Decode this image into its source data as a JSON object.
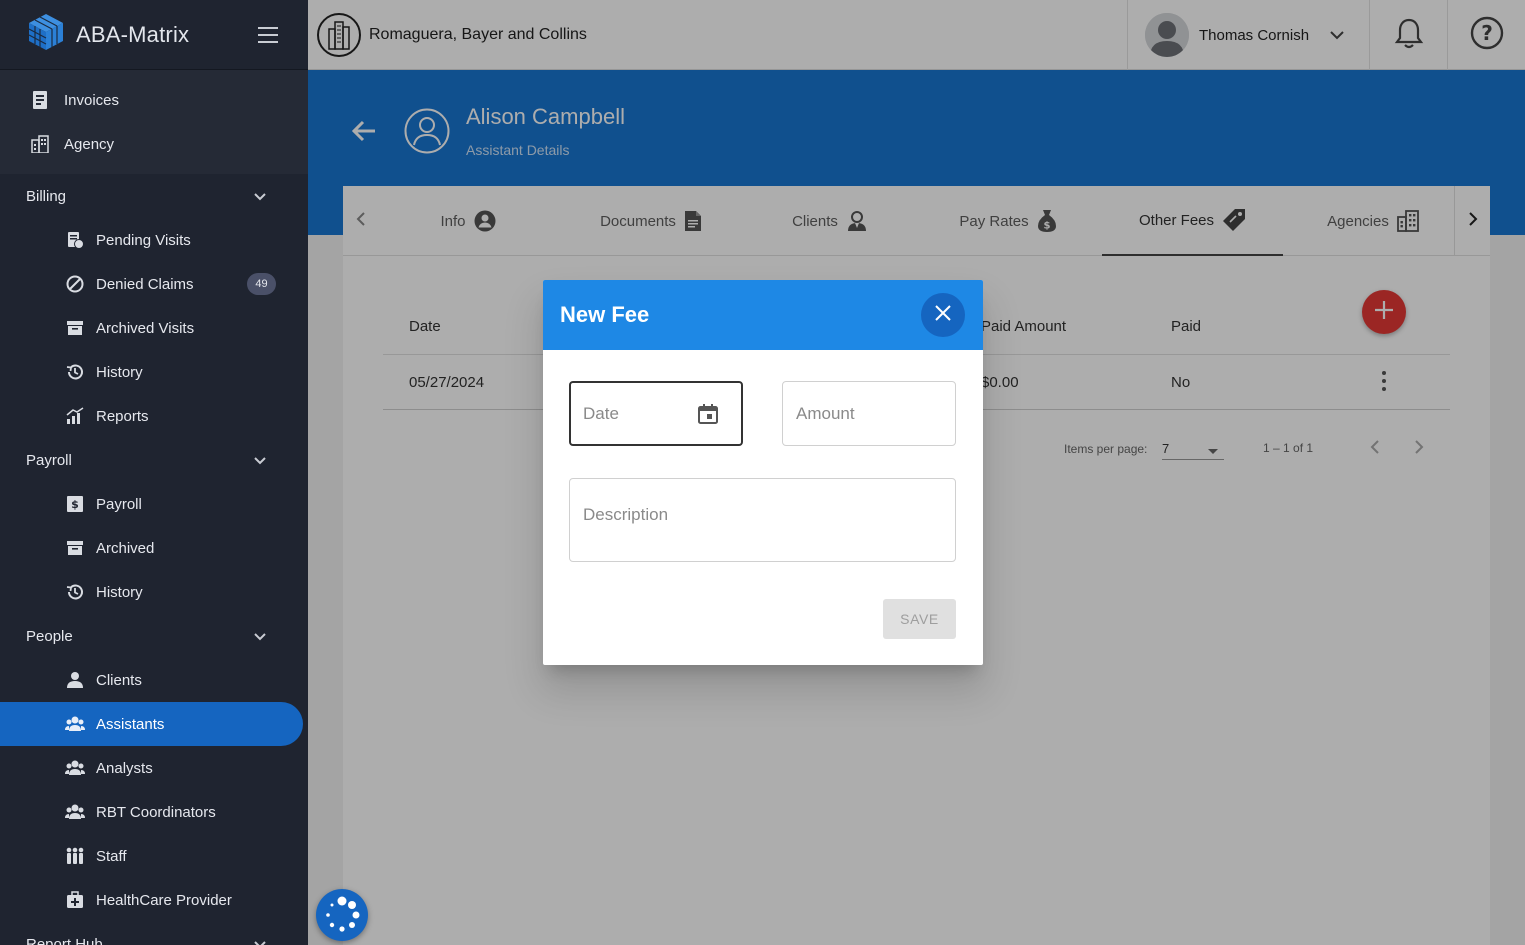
{
  "app": {
    "name": "ABA-Matrix"
  },
  "topbar": {
    "org_name": "Romaguera, Bayer and Collins",
    "user_name": "Thomas Cornish"
  },
  "sidebar": {
    "top_items": [
      {
        "label": "Invoices",
        "icon": "invoice-icon"
      },
      {
        "label": "Agency",
        "icon": "building-icon"
      }
    ],
    "billing": {
      "label": "Billing",
      "items": [
        {
          "label": "Pending Visits",
          "icon": "pending-visits-icon"
        },
        {
          "label": "Denied Claims",
          "icon": "denied-icon",
          "badge": "49"
        },
        {
          "label": "Archived Visits",
          "icon": "archive-icon"
        },
        {
          "label": "History",
          "icon": "history-icon"
        },
        {
          "label": "Reports",
          "icon": "reports-icon"
        }
      ]
    },
    "payroll": {
      "label": "Payroll",
      "items": [
        {
          "label": "Payroll",
          "icon": "payroll-icon"
        },
        {
          "label": "Archived",
          "icon": "archive-icon"
        },
        {
          "label": "History",
          "icon": "history-icon"
        }
      ]
    },
    "people": {
      "label": "People",
      "items": [
        {
          "label": "Clients",
          "icon": "person-icon"
        },
        {
          "label": "Assistants",
          "icon": "group-icon",
          "active": true
        },
        {
          "label": "Analysts",
          "icon": "group-icon"
        },
        {
          "label": "RBT Coordinators",
          "icon": "group-icon"
        },
        {
          "label": "Staff",
          "icon": "staff-icon"
        },
        {
          "label": "HealthCare Provider",
          "icon": "medical-kit-icon"
        }
      ]
    },
    "report_hub": {
      "label": "Report Hub"
    }
  },
  "header": {
    "name": "Alison Campbell",
    "subtitle": "Assistant Details"
  },
  "tabs": [
    {
      "label": "Info",
      "icon": "account-circle-icon"
    },
    {
      "label": "Documents",
      "icon": "document-icon"
    },
    {
      "label": "Clients",
      "icon": "client-icon"
    },
    {
      "label": "Pay Rates",
      "icon": "money-bag-icon"
    },
    {
      "label": "Other Fees",
      "icon": "tag-icon",
      "active": true
    },
    {
      "label": "Agencies",
      "icon": "building-icon"
    }
  ],
  "table": {
    "columns": [
      "Date",
      "Paid Amount",
      "Paid"
    ],
    "rows": [
      {
        "date": "05/27/2024",
        "paid_amount": "$0.00",
        "paid": "No"
      }
    ]
  },
  "paginator": {
    "items_per_page_label": "Items per page:",
    "items_per_page": "7",
    "range": "1 – 1 of 1"
  },
  "dialog": {
    "title": "New Fee",
    "date_placeholder": "Date",
    "amount_placeholder": "Amount",
    "description_placeholder": "Description",
    "save_label": "SAVE"
  },
  "colors": {
    "sidebar_bg": "#1f2430",
    "primary": "#1976d2",
    "dialog_header": "#1e88e5",
    "fab_red": "#e53935"
  }
}
